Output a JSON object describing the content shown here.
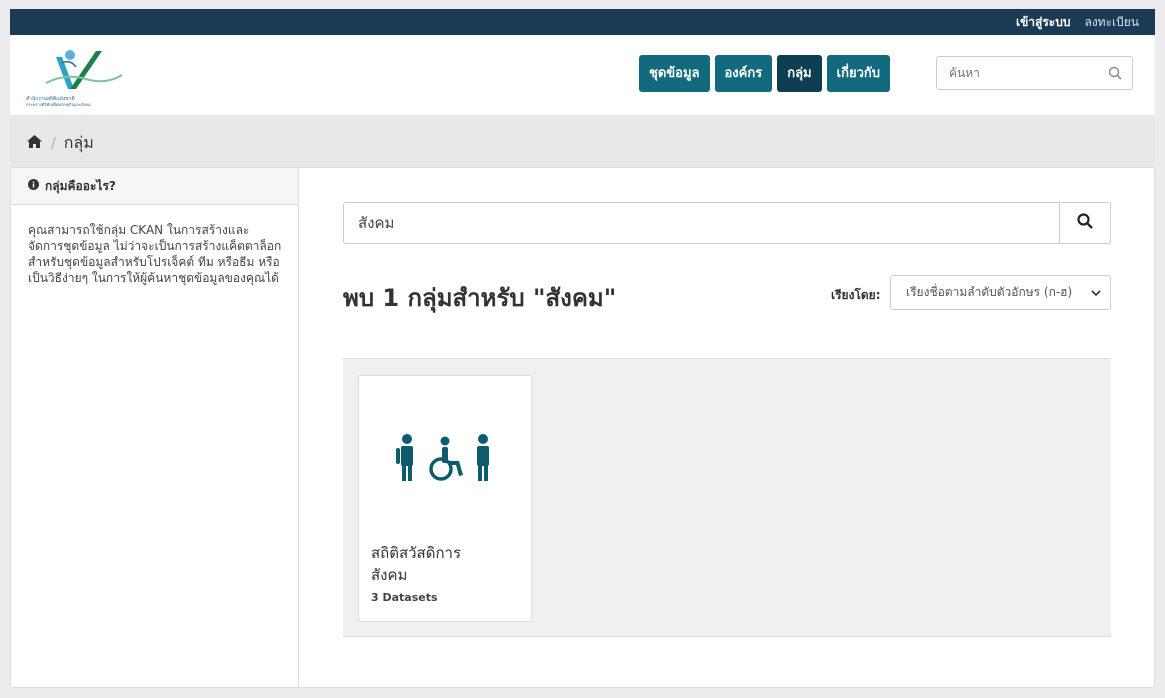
{
  "account": {
    "login_label": "เข้าสู่ระบบ",
    "register_label": "ลงทะเบียน"
  },
  "logo": {
    "line1": "สำนักงานสถิติแห่งชาติ",
    "line2": "กระทรวงดิจิทัลเพื่อเศรษฐกิจและสังคม"
  },
  "nav": {
    "items": [
      {
        "label": "ชุดข้อมูล",
        "active": false
      },
      {
        "label": "องค์กร",
        "active": false
      },
      {
        "label": "กลุ่ม",
        "active": true
      },
      {
        "label": "เกี่ยวกับ",
        "active": false
      }
    ]
  },
  "site_search": {
    "placeholder": "ค้นหา",
    "icon": "search-icon"
  },
  "breadcrumb": {
    "home_icon": "home-icon",
    "separator": "/",
    "current": "กลุ่ม"
  },
  "sidebar": {
    "heading": "กลุ่มคืออะไร?",
    "body": "คุณสามารถใช้กลุ่ม CKAN ในการสร้างและจัดการชุดข้อมูล ไม่ว่าจะเป็นการสร้างแค็ตตาล็อกสำหรับชุดข้อมูลสำหรับโปรเจ็คต์ ทีม หรือธีม หรือเป็นวิธีง่ายๆ ในการให้ผู้ค้นหาชุดข้อมูลของคุณได้"
  },
  "group_search": {
    "value": "สังคม"
  },
  "results": {
    "title": "พบ 1 กลุ่มสำหรับ \"สังคม\""
  },
  "sort": {
    "label": "เรียงโดย:",
    "selected": "เรียงชื่อตามลำดับตัวอักษร (ก-ฮ)"
  },
  "groups": [
    {
      "title": "สถิติสวัสดิการสังคม",
      "title_line1": "สถิติสวัสดิการ",
      "title_line2": "สังคม",
      "count": "3 Datasets",
      "icon": "people-accessibility-icon",
      "icon_color": "#0e5a6e"
    }
  ],
  "colors": {
    "nav_bg": "#126a7f",
    "nav_active": "#0d3e52",
    "account_bar": "#1b3a55"
  }
}
